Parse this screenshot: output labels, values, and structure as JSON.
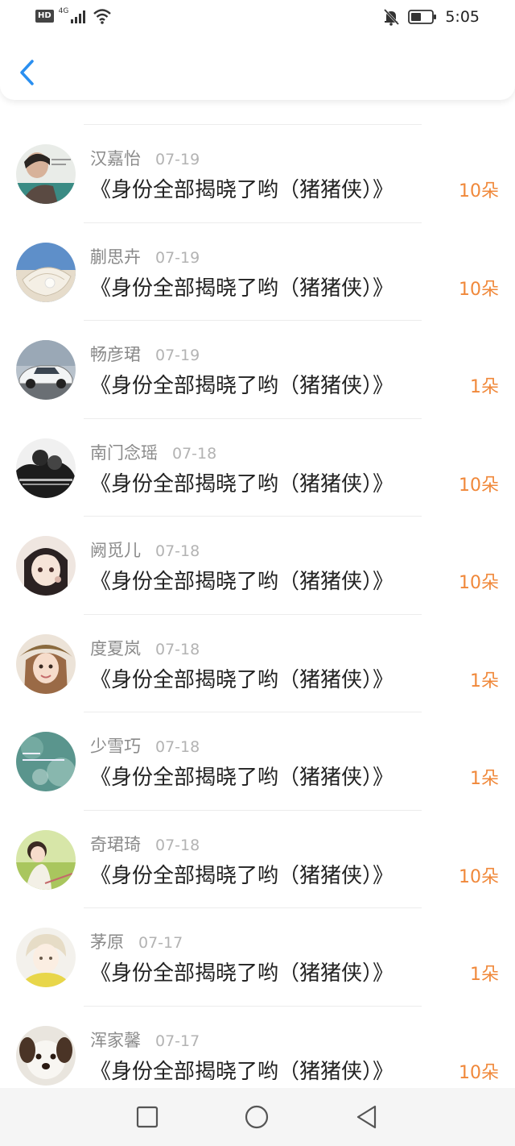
{
  "status_bar": {
    "hd": "HD",
    "network": "4G",
    "time": "5:05"
  },
  "header": {
    "back_icon": "chevron-left-icon"
  },
  "colors": {
    "accent_blue": "#2a8ff0",
    "count_orange": "#f0883a",
    "name_gray": "#8a8a8a",
    "date_gray": "#b3b3b3"
  },
  "gifts": [
    {
      "name": "汉嘉怡",
      "date": "07-19",
      "title": "《身份全部揭晓了哟（猪猪侠）》",
      "count": "10朵",
      "avatar": "person-avatar"
    },
    {
      "name": "蒯思卉",
      "date": "07-19",
      "title": "《身份全部揭晓了哟（猪猪侠）》",
      "count": "10朵",
      "avatar": "pearl-shell-avatar"
    },
    {
      "name": "畅彦珺",
      "date": "07-19",
      "title": "《身份全部揭晓了哟（猪猪侠）》",
      "count": "1朵",
      "avatar": "car-avatar"
    },
    {
      "name": "南门念瑶",
      "date": "07-18",
      "title": "《身份全部揭晓了哟（猪猪侠）》",
      "count": "10朵",
      "avatar": "couple-avatar"
    },
    {
      "name": "阙觅儿",
      "date": "07-18",
      "title": "《身份全部揭晓了哟（猪猪侠）》",
      "count": "10朵",
      "avatar": "anime-girl-avatar"
    },
    {
      "name": "度夏岚",
      "date": "07-18",
      "title": "《身份全部揭晓了哟（猪猪侠）》",
      "count": "1朵",
      "avatar": "girl-hat-avatar"
    },
    {
      "name": "少雪巧",
      "date": "07-18",
      "title": "《身份全部揭晓了哟（猪猪侠）》",
      "count": "1朵",
      "avatar": "teal-text-avatar"
    },
    {
      "name": "奇珺琦",
      "date": "07-18",
      "title": "《身份全部揭晓了哟（猪猪侠）》",
      "count": "10朵",
      "avatar": "girl-field-avatar"
    },
    {
      "name": "茅原",
      "date": "07-17",
      "title": "《身份全部揭晓了哟（猪猪侠）》",
      "count": "1朵",
      "avatar": "anime-boy-avatar"
    },
    {
      "name": "浑家馨",
      "date": "07-17",
      "title": "《身份全部揭晓了哟（猪猪侠）》",
      "count": "10朵",
      "avatar": "puppy-avatar"
    }
  ],
  "nav": {
    "recent": "square-icon",
    "home": "circle-icon",
    "back": "triangle-back-icon"
  }
}
